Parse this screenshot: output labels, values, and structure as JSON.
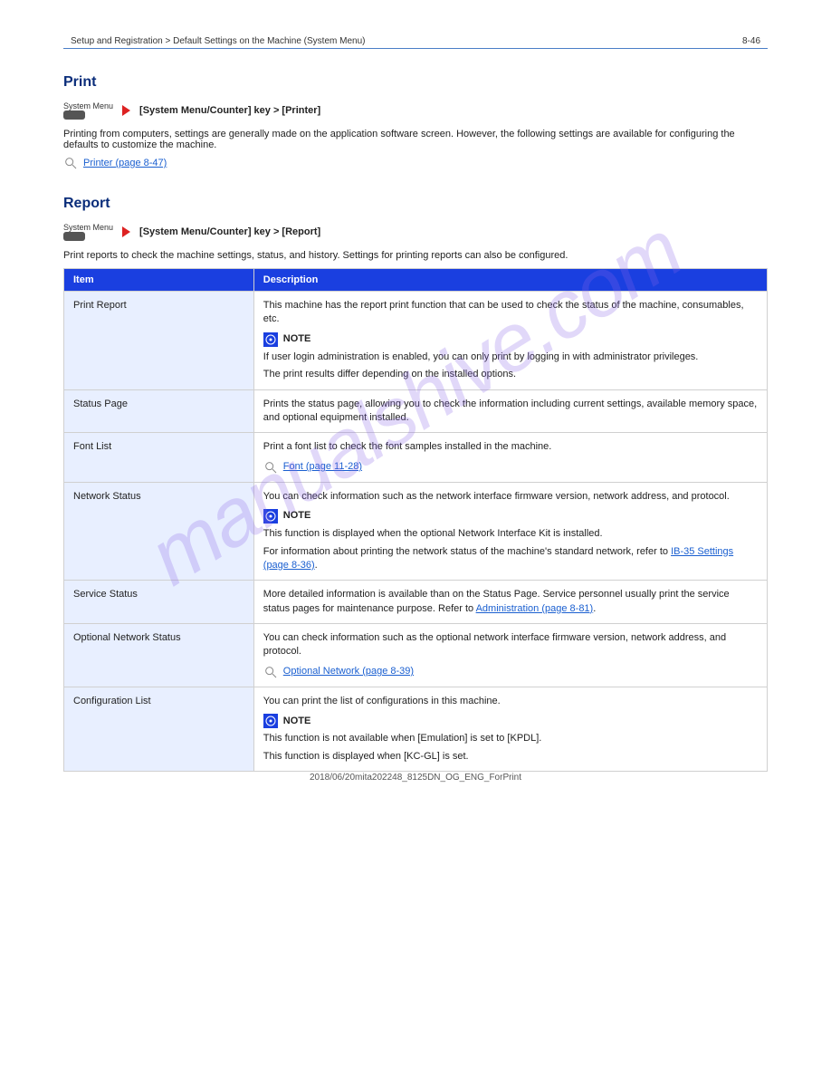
{
  "header": {
    "left": "Setup and Registration > Default Settings on the Machine (System Menu)",
    "right": "8-46"
  },
  "watermark": "manualshive.com",
  "sections": {
    "print": {
      "title": "Print",
      "nav_label_above": "System Menu",
      "nav_text": "[System Menu/Counter] key > [Printer]",
      "desc1": "Printing from computers, settings are generally made on the application software screen. However, the following settings are available for configuring the defaults to customize the machine.",
      "ref_text": "Printer (page 8-47)"
    },
    "report": {
      "title": "Report",
      "nav_label_above": "System Menu",
      "nav_text": "[System Menu/Counter] key > [Report]",
      "desc1": "Print reports to check the machine settings, status, and history. Settings for printing reports can also be configured."
    }
  },
  "table": {
    "header_item": "Item",
    "header_desc": "Description",
    "rows": [
      {
        "item": "Print Report",
        "body1": "This machine has the report print function that can be used to check the status of the machine, consumables, etc.",
        "note_prefix": "NOTE",
        "note1": "If user login administration is enabled, you can only print by logging in with administrator privileges.",
        "note2": "The print results differ depending on the installed options."
      },
      {
        "item": "Status Page",
        "body1": "Prints the status page, allowing you to check the information including current settings, available memory space, and optional equipment installed."
      },
      {
        "item": "Font List",
        "body1": "Print a font list to check the font samples installed in the machine.",
        "ref": "Font (page 11-28)"
      },
      {
        "item": "Network Status",
        "body1": "You can check information such as the network interface firmware version, network address, and protocol.",
        "note_prefix": "NOTE",
        "note1": "This function is displayed when the optional Network Interface Kit is installed.",
        "note2a": "For information about printing the network status of the machine's standard network, refer to ",
        "note2_link": "IB-35 Settings (page 8-36)",
        "note2b": "."
      },
      {
        "item": "Service Status",
        "body1": "More detailed information is available than on the Status Page. Service personnel usually print the service status pages for maintenance purpose. Refer to ",
        "body1_link": "Administration (page 8-81)",
        "body1_after": "."
      },
      {
        "item": "Optional Network Status",
        "body1": "You can check information such as the optional network interface firmware version, network address, and protocol.",
        "ref": "Optional Network (page 8-39)"
      },
      {
        "item": "Configuration List",
        "body1": "You can print the list of configurations in this machine.",
        "note_prefix": "NOTE",
        "note1": "This function is not available when [Emulation] is set to [KPDL].",
        "note2": "This function is displayed when [KC-GL] is set."
      }
    ]
  },
  "footer": "2018/06/20mita202248_8125DN_OG_ENG_ForPrint"
}
